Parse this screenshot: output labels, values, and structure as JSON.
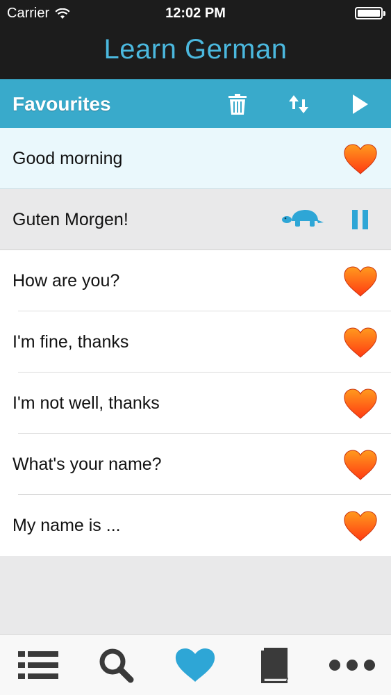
{
  "status_bar": {
    "carrier": "Carrier",
    "time": "12:02 PM"
  },
  "app": {
    "title": "Learn German"
  },
  "section": {
    "title": "Favourites",
    "actions": [
      "trash-icon",
      "sort-icon",
      "play-icon"
    ]
  },
  "phrases": [
    {
      "text": "Good morning",
      "favourite": true,
      "state": "selected"
    },
    {
      "text": "Guten Morgen!",
      "state": "translation",
      "controls": [
        "tortoise-icon",
        "pause-icon"
      ]
    },
    {
      "text": "How are you?",
      "favourite": true
    },
    {
      "text": "I'm fine, thanks",
      "favourite": true
    },
    {
      "text": "I'm not well, thanks",
      "favourite": true
    },
    {
      "text": "What's your name?",
      "favourite": true
    },
    {
      "text": "My name is ...",
      "favourite": true
    }
  ],
  "tab_bar": {
    "tabs": [
      "list-icon",
      "search-icon",
      "heart-icon",
      "book-icon",
      "more-icon"
    ],
    "active": "heart-icon"
  },
  "colors": {
    "accent": "#39aacb",
    "title_text": "#4bb8de",
    "active_tab": "#2ea6d6",
    "heart_top": "#ff9a1e",
    "heart_bottom": "#ff3a12"
  }
}
